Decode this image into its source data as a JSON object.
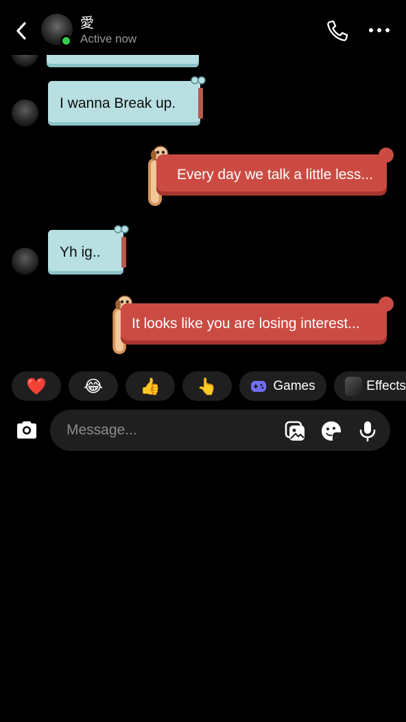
{
  "header": {
    "name": "愛",
    "status": "Active now"
  },
  "messages": [
    {
      "direction": "in",
      "text": "I wanna Break up."
    },
    {
      "direction": "out",
      "text": "Every day we talk a little less..."
    },
    {
      "direction": "in",
      "text": "Yh ig.."
    },
    {
      "direction": "out",
      "text": "It looks like you are losing interest..."
    }
  ],
  "quick_reactions": [
    {
      "emoji": "❤️",
      "icon": "heart-icon"
    },
    {
      "emoji": "😂",
      "icon": "tears-of-joy-icon"
    },
    {
      "emoji": "👍",
      "icon": "thumbs-up-icon"
    },
    {
      "emoji": "👆",
      "icon": "pointing-up-icon"
    }
  ],
  "chips": {
    "games": "Games",
    "effects": "Effects"
  },
  "composer": {
    "placeholder": "Message..."
  },
  "colors": {
    "incoming_bubble": "#b8dfe2",
    "outgoing_bubble": "#cb4b43",
    "online": "#33cc4d",
    "games_icon": "#6f6ef5"
  }
}
